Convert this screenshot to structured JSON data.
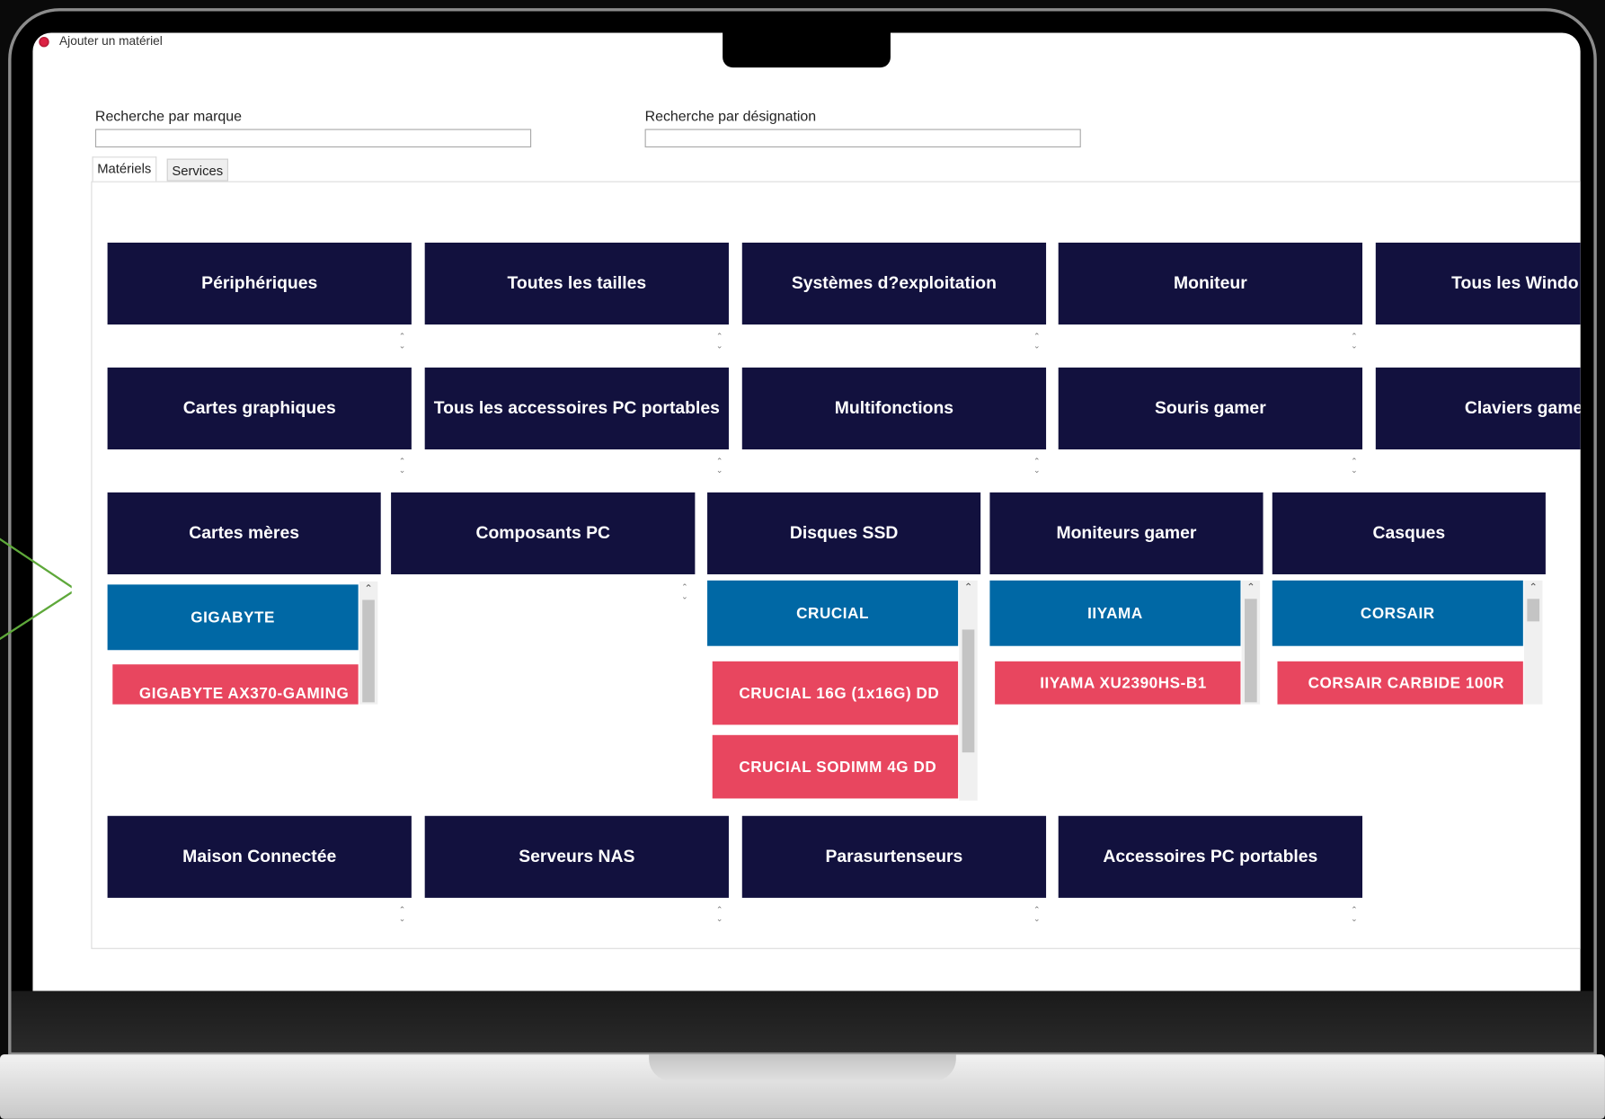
{
  "window": {
    "title": "Ajouter un matériel"
  },
  "search": {
    "brand_label": "Recherche par marque",
    "brand_value": "",
    "designation_label": "Recherche par désignation",
    "designation_value": ""
  },
  "tabs": [
    {
      "label": "Matériels",
      "active": true
    },
    {
      "label": "Services",
      "active": false
    }
  ],
  "categories": {
    "row1": [
      "Périphériques",
      "Toutes les tailles",
      "Systèmes d?exploitation",
      "Moniteur",
      "Tous les Windo"
    ],
    "row2": [
      "Cartes graphiques",
      "Tous les accessoires PC portables",
      "Multifonctions",
      "Souris gamer",
      "Claviers game"
    ],
    "row3": [
      "Cartes mères",
      "Composants PC",
      "Disques SSD",
      "Moniteurs gamer",
      "Casques"
    ],
    "row4": [
      "Maison Connectée",
      "Serveurs NAS",
      "Parasurtenseurs",
      "Accessoires PC portables"
    ]
  },
  "expanded": {
    "cartes_meres": {
      "brand": "GIGABYTE",
      "products": [
        "GIGABYTE AX370-GAMING"
      ]
    },
    "disques_ssd": {
      "brand": "CRUCIAL",
      "products": [
        "CRUCIAL 16G (1x16G) DD",
        "CRUCIAL SODIMM 4G DD"
      ]
    },
    "moniteurs_gamer": {
      "brand": "IIYAMA",
      "products": [
        "IIYAMA XU2390HS-B1"
      ]
    },
    "casques": {
      "brand": "CORSAIR",
      "products": [
        "CORSAIR CARBIDE 100R"
      ]
    }
  },
  "colors": {
    "category_bg": "#12113e",
    "brand_bg": "#0068a5",
    "product_bg": "#e8465f",
    "arrow": "#5ea83a"
  },
  "icons": {
    "app": "app-icon",
    "spinner": "spinner-updown-icon",
    "scroll_up": "chevron-up-icon"
  }
}
